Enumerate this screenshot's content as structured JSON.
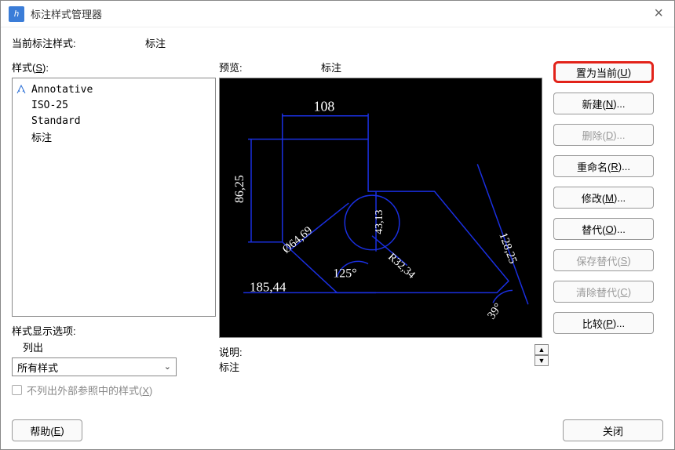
{
  "title": "标注样式管理器",
  "current_style_label": "当前标注样式:",
  "current_style_value": "标注",
  "styles_label": "样式(S):",
  "styles_hotkey": "S",
  "styles_list": [
    "Annotative",
    "ISO-25",
    "Standard",
    "标注"
  ],
  "display_opts": {
    "label": "样式显示选项:",
    "list_label": "列出",
    "select_value": "所有样式",
    "checkbox_label": "不列出外部参照中的样式(X)",
    "checkbox_hotkey": "X"
  },
  "preview": {
    "label": "预览:",
    "style": "标注"
  },
  "cad_values": {
    "top_dim": "108",
    "left_dim": "86,25",
    "center_dim": "43,13",
    "right_dim": "128,25",
    "diag_dia": "Ø64,69",
    "radius": "R32,34",
    "angle1": "125°",
    "bottom_dim": "185,44",
    "angle2": "39°"
  },
  "desc": {
    "label": "说明:",
    "value": "标注"
  },
  "buttons": {
    "set_current": "置为当前(U)",
    "new": "新建(N)...",
    "delete": "删除(D)...",
    "rename": "重命名(R)...",
    "modify": "修改(M)...",
    "override": "替代(O)...",
    "save_override": "保存替代(S)",
    "clear_override": "清除替代(C)",
    "compare": "比较(P)...",
    "help": "帮助(E)",
    "close": "关闭"
  }
}
